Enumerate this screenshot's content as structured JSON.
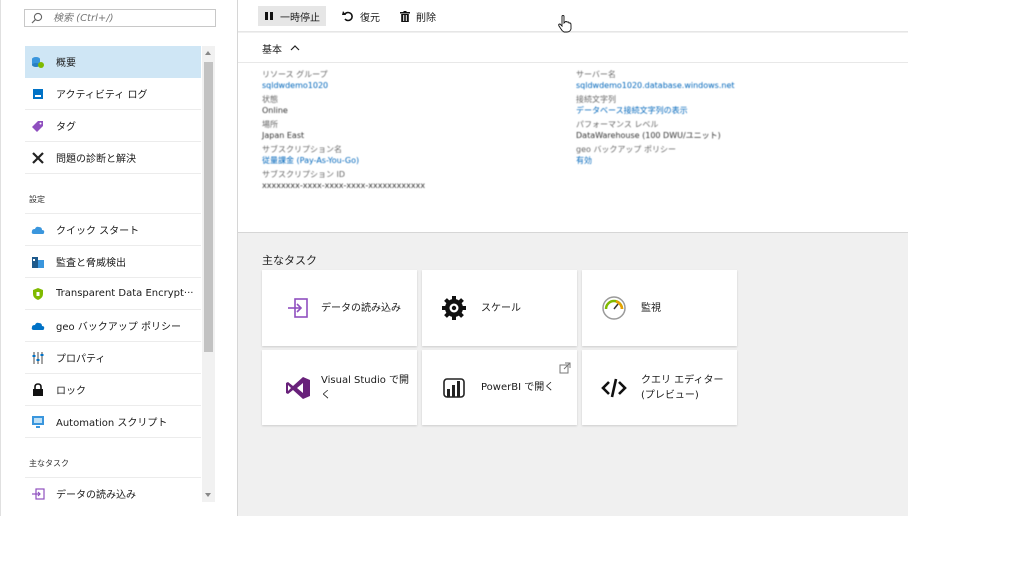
{
  "search": {
    "placeholder": "検索 (Ctrl+/)"
  },
  "menu": {
    "items": [
      {
        "label": "概要",
        "icon": "overview-icon"
      },
      {
        "label": "アクティビティ ログ",
        "icon": "activity-log-icon"
      },
      {
        "label": "タグ",
        "icon": "tag-icon"
      },
      {
        "label": "問題の診断と解決",
        "icon": "diagnose-icon"
      }
    ],
    "section_settings": "設定",
    "settings_items": [
      {
        "label": "クイック スタート",
        "icon": "cloud-icon"
      },
      {
        "label": "監査と脅威検出",
        "icon": "audit-icon"
      },
      {
        "label": "Transparent Data Encrypt···",
        "icon": "shield-icon"
      },
      {
        "label": "geo バックアップ ポリシー",
        "icon": "cloud-backup-icon"
      },
      {
        "label": "プロパティ",
        "icon": "properties-icon"
      },
      {
        "label": "ロック",
        "icon": "lock-icon"
      },
      {
        "label": "Automation スクリプト",
        "icon": "automation-icon"
      }
    ],
    "section_tasks": "主なタスク",
    "tasks_items": [
      {
        "label": "データの読み込み",
        "icon": "load-data-icon"
      }
    ]
  },
  "toolbar": {
    "pause": "一時停止",
    "resume": "復元",
    "delete": "削除"
  },
  "essentials": {
    "header": "基本",
    "left": [
      {
        "key": "リソース グループ",
        "value": "sqldwdemo1020",
        "link": true
      },
      {
        "key": "状態",
        "value": "Online",
        "link": false
      },
      {
        "key": "場所",
        "value": "Japan East",
        "link": false
      },
      {
        "key": "サブスクリプション名",
        "value": "従量課金 (Pay-As-You-Go)",
        "link": true
      },
      {
        "key": "サブスクリプション ID",
        "value": "xxxxxxxx-xxxx-xxxx-xxxx-xxxxxxxxxxxx",
        "link": false
      }
    ],
    "right": [
      {
        "key": "サーバー名",
        "value": "sqldwdemo1020.database.windows.net",
        "link": true
      },
      {
        "key": "接続文字列",
        "value": "データベース接続文字列の表示",
        "link": true
      },
      {
        "key": "パフォーマンス レベル",
        "value": "DataWarehouse (100 DWU/ユニット)",
        "link": false
      },
      {
        "key": "geo バックアップ ポリシー",
        "value": "有効",
        "link": true
      }
    ]
  },
  "tasks": {
    "title": "主なタスク",
    "tiles": [
      {
        "label": "データの読み込み",
        "icon": "load-data-icon"
      },
      {
        "label": "スケール",
        "icon": "scale-gear-icon"
      },
      {
        "label": "監視",
        "icon": "monitor-gauge-icon"
      },
      {
        "label": "Visual Studio で開く",
        "icon": "visual-studio-icon"
      },
      {
        "label": "PowerBI で開く",
        "icon": "powerbi-icon"
      },
      {
        "label": "クエリ エディター (プレビュー)",
        "icon": "code-icon"
      }
    ]
  },
  "colors": {
    "selected": "#cfe6f5",
    "link": "#0066bb",
    "accent": "#0072c6"
  }
}
